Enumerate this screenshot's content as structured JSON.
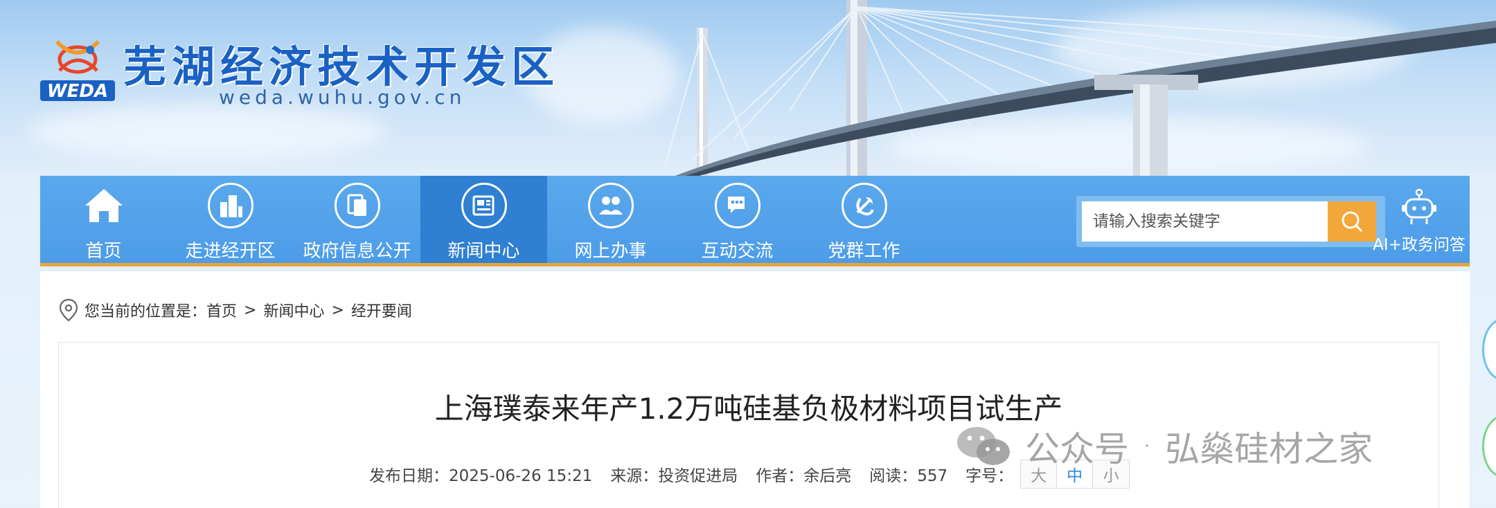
{
  "header": {
    "logo_text": "WEDA",
    "title": "芜湖经济技术开发区",
    "url": "weda.wuhu.gov.cn"
  },
  "nav": {
    "items": [
      {
        "label": "首页",
        "icon": "home-icon"
      },
      {
        "label": "走进经开区",
        "icon": "buildings-icon"
      },
      {
        "label": "政府信息公开",
        "icon": "documents-icon"
      },
      {
        "label": "新闻中心",
        "icon": "newspaper-icon",
        "active": true
      },
      {
        "label": "网上办事",
        "icon": "people-icon"
      },
      {
        "label": "互动交流",
        "icon": "chat-icon"
      },
      {
        "label": "党群工作",
        "icon": "party-emblem-icon"
      }
    ],
    "search_placeholder": "请输入搜索关键字",
    "ai_label": "AI+政务问答"
  },
  "breadcrumb": {
    "prefix": "您当前的位置是：",
    "items": [
      "首页",
      "新闻中心",
      "经开要闻"
    ],
    "separator": ">"
  },
  "article": {
    "title": "上海璞泰来年产1.2万吨硅基负极材料项目试生产",
    "publish_date": "发布日期：2025-06-26 15:21",
    "source": "来源：投资促进局",
    "author": "作者：余后亮",
    "reads": "阅读：557",
    "font_size_label": "字号：",
    "font_sizes": [
      "大",
      "中",
      "小"
    ],
    "active_font_size": "中"
  },
  "watermark": {
    "left": "公众号",
    "dot": "·",
    "right": "弘燊硅材之家"
  },
  "colors": {
    "nav_blue": "#4d9ce8",
    "nav_active": "#2f7fd3",
    "accent_orange": "#f3a73a",
    "title_blue": "#1a61c4"
  }
}
